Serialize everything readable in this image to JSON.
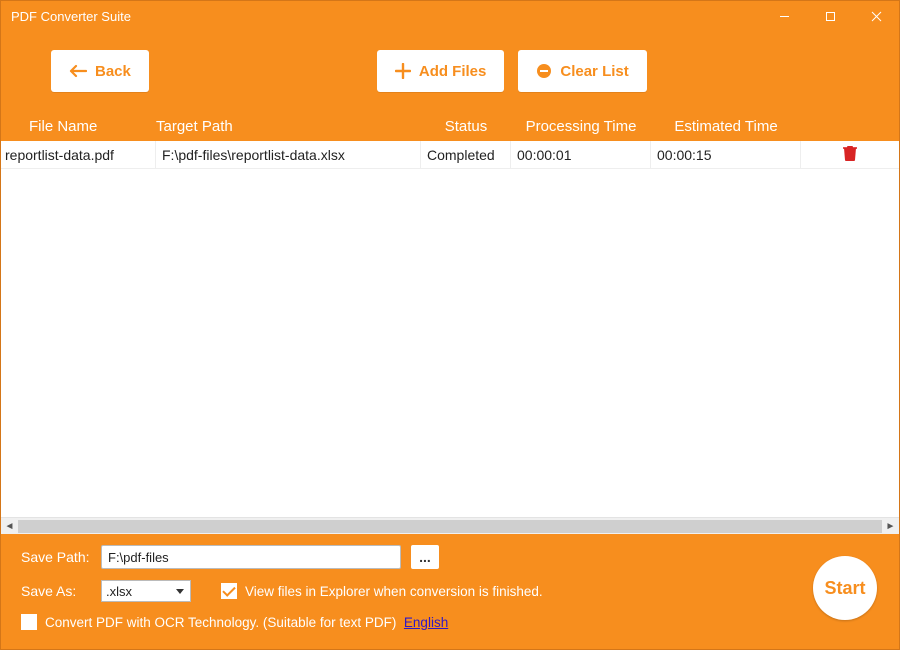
{
  "window": {
    "title": "PDF Converter Suite"
  },
  "toolbar": {
    "back_label": "Back",
    "add_files_label": "Add Files",
    "clear_list_label": "Clear List"
  },
  "table": {
    "headers": {
      "file": "File Name",
      "target": "Target Path",
      "status": "Status",
      "processing_time": "Processing Time",
      "estimated_time": "Estimated Time"
    },
    "rows": [
      {
        "file": "reportlist-data.pdf",
        "target": "F:\\pdf-files\\reportlist-data.xlsx",
        "status": "Completed",
        "processing_time": "00:00:01",
        "estimated_time": "00:00:15"
      }
    ]
  },
  "bottom": {
    "save_path_label": "Save Path:",
    "save_path_value": "F:\\pdf-files",
    "browse_label": "...",
    "save_as_label": "Save As:",
    "save_as_value": ".xlsx",
    "view_in_explorer_checked": true,
    "view_in_explorer_label": "View files in Explorer when conversion is finished.",
    "ocr_checked": false,
    "ocr_label": "Convert PDF with OCR Technology. (Suitable for text PDF)",
    "ocr_language": "English",
    "start_label": "Start"
  }
}
